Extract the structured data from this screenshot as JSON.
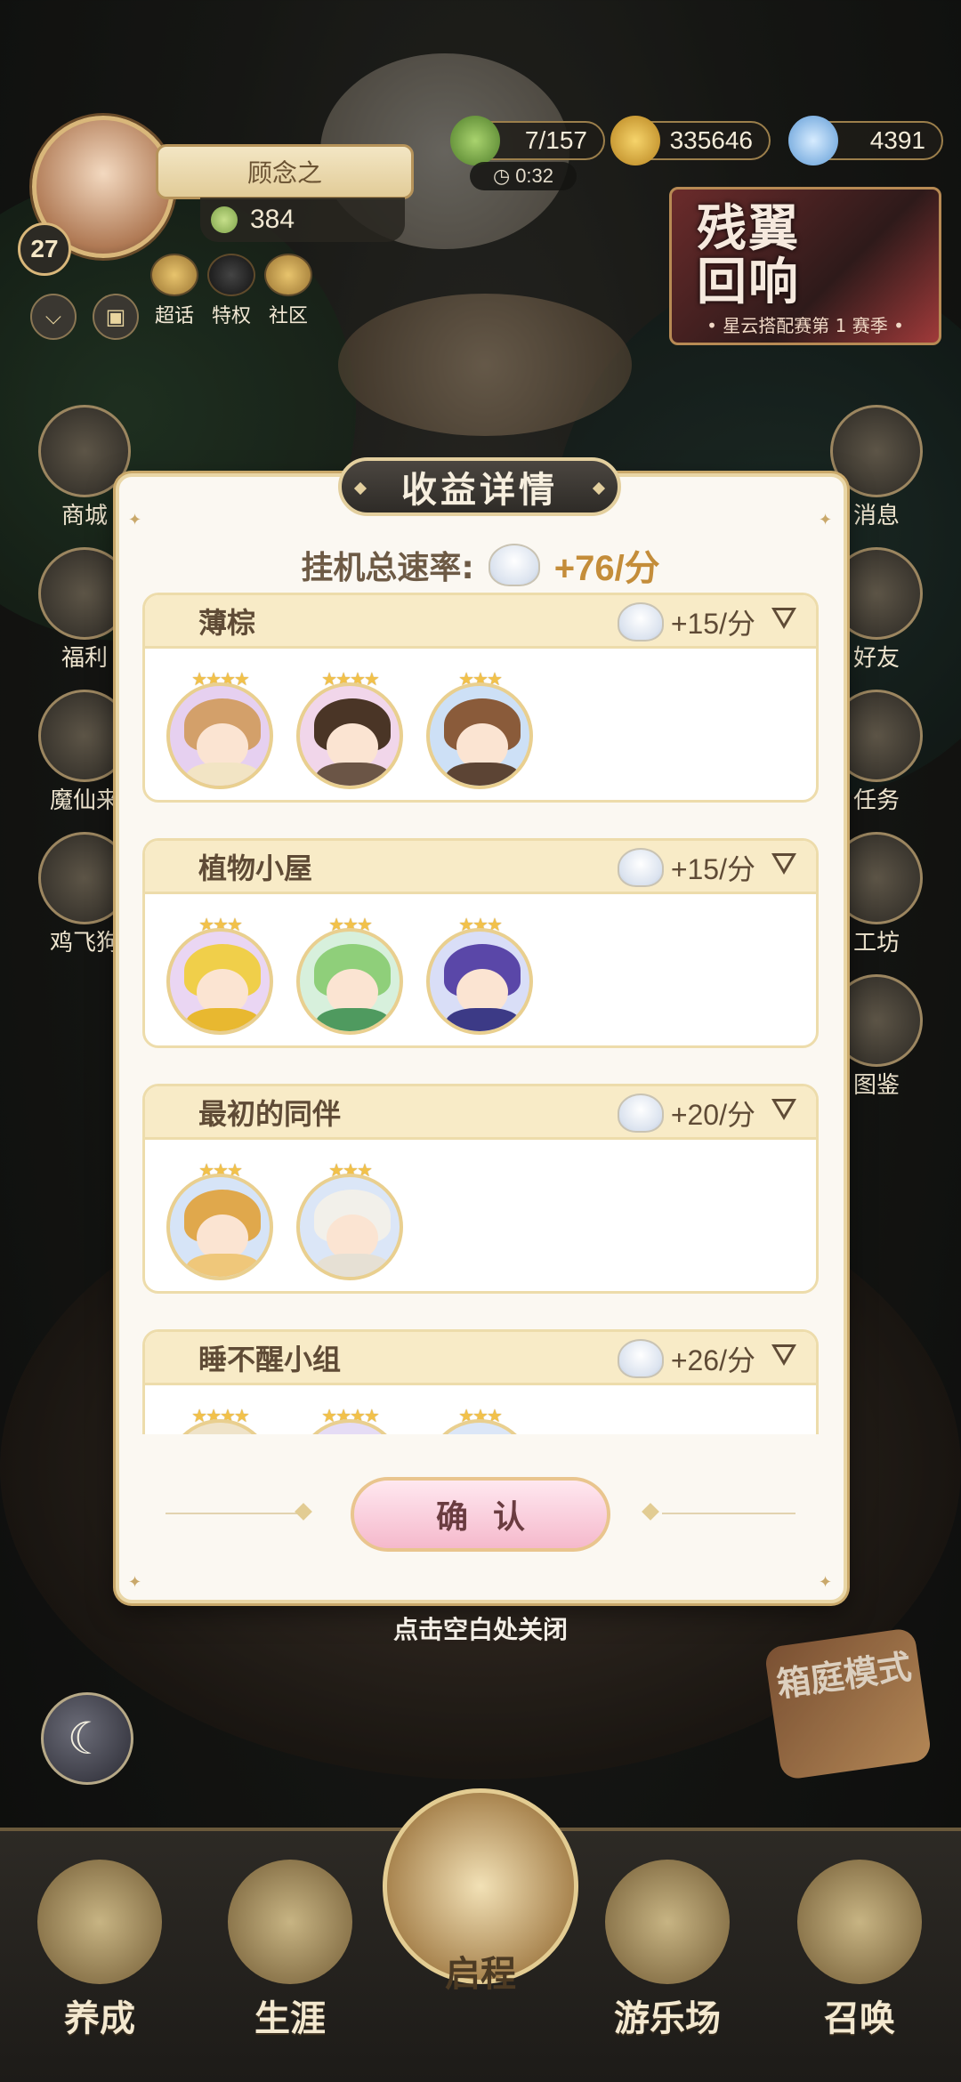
{
  "player": {
    "name": "顾念之",
    "level": "27",
    "clovers": "384"
  },
  "resources": {
    "stamina": "7/157",
    "timer": "0:32",
    "coins": "335646",
    "gems": "4391"
  },
  "shortcuts": [
    {
      "label": "超话"
    },
    {
      "label": "特权"
    },
    {
      "label": "社区"
    }
  ],
  "banner": {
    "title": "残翼回响",
    "subtitle": "• 星云搭配赛第 1 赛季 •"
  },
  "left_menu": [
    {
      "label": "商城"
    },
    {
      "label": "福利"
    },
    {
      "label": "魔仙来"
    },
    {
      "label": "鸡飞狗"
    }
  ],
  "right_menu": [
    {
      "label": "消息"
    },
    {
      "label": "好友"
    },
    {
      "label": "任务"
    },
    {
      "label": "工坊"
    },
    {
      "label": "图鉴"
    }
  ],
  "modal": {
    "title": "收益详情",
    "total_label": "挂机总速率:",
    "total_value": "+76/分",
    "groups": [
      {
        "name": "薄棕",
        "rate": "+15/分",
        "stars": [
          4,
          4,
          3
        ]
      },
      {
        "name": "植物小屋",
        "rate": "+15/分",
        "stars": [
          3,
          3,
          3
        ]
      },
      {
        "name": "最初的同伴",
        "rate": "+20/分",
        "stars": [
          3,
          3
        ]
      },
      {
        "name": "睡不醒小组",
        "rate": "+26/分",
        "stars": [
          4,
          4,
          3
        ]
      }
    ],
    "confirm": "确认",
    "close_hint": "点击空白处关闭"
  },
  "mode_button": "箱庭模式",
  "bottom_nav": [
    {
      "label": "养成"
    },
    {
      "label": "生涯"
    },
    {
      "label": "启程"
    },
    {
      "label": "游乐场"
    },
    {
      "label": "召唤"
    }
  ],
  "colors": {
    "accent_gold": "#c48d3a",
    "panel_bg": "#fbf8f2",
    "group_header": "#f8ebc7",
    "confirm_pink": "#f5b9cc"
  }
}
